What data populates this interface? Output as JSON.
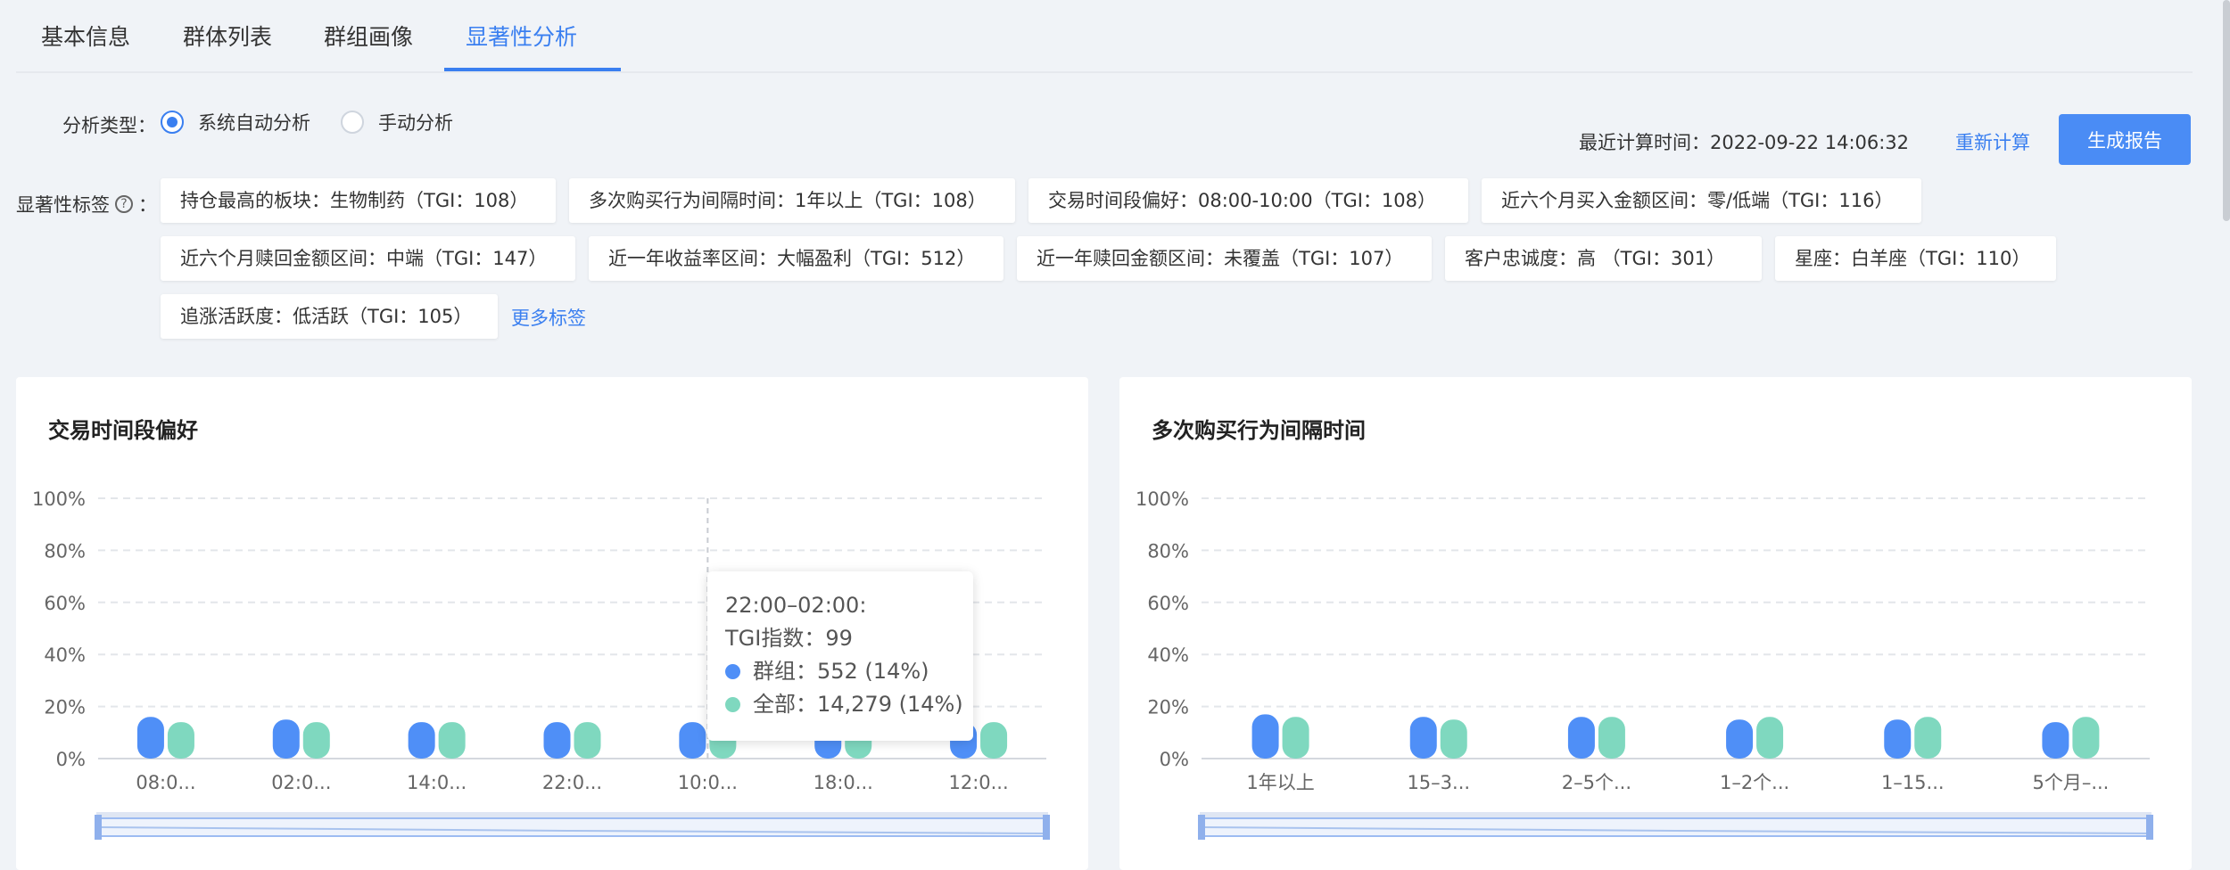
{
  "tabs": [
    {
      "label": "基本信息",
      "active": false
    },
    {
      "label": "群体列表",
      "active": false
    },
    {
      "label": "群组画像",
      "active": false
    },
    {
      "label": "显著性分析",
      "active": true
    }
  ],
  "analysis": {
    "label": "分析类型：",
    "options": [
      {
        "label": "系统自动分析",
        "selected": true
      },
      {
        "label": "手动分析",
        "selected": false
      }
    ],
    "last_calc": "最近计算时间：2022-09-22 14:06:32",
    "recalc_label": "重新计算",
    "generate_label": "生成报告"
  },
  "tags": {
    "label": "显著性标签",
    "colon": "：",
    "items": [
      "持仓最高的板块：生物制药（TGI：108）",
      "多次购买行为间隔时间：1年以上（TGI：108）",
      "交易时间段偏好：08:00-10:00（TGI：108）",
      "近六个月买入金额区间：零/低端（TGI：116）",
      "近六个月赎回金额区间：中端（TGI：147）",
      "近一年收益率区间：大幅盈利（TGI：512）",
      "近一年赎回金额区间：未覆盖（TGI：107）",
      "客户忠诚度：高 （TGI：301）",
      "星座：白羊座（TGI：110）",
      "追涨活跃度：低活跃（TGI：105）"
    ],
    "more_label": "更多标签"
  },
  "colors": {
    "group": "#4f8ff7",
    "all": "#7fd8bf",
    "accent": "#3a7ff0"
  },
  "icons": {
    "help": "question-circle-icon"
  },
  "charts": [
    {
      "title": "交易时间段偏好",
      "chart_data": {
        "type": "bar",
        "categories": [
          "08:0...",
          "02:0...",
          "14:0...",
          "22:0...",
          "10:0...",
          "18:0...",
          "12:0..."
        ],
        "series": [
          {
            "name": "群组",
            "values": [
              16,
              15,
              14,
              14,
              14,
              14,
              14
            ]
          },
          {
            "name": "全部",
            "values": [
              14,
              14,
              14,
              14,
              14,
              14,
              14
            ]
          }
        ],
        "y_ticks": [
          "0%",
          "20%",
          "40%",
          "60%",
          "80%",
          "100%"
        ],
        "ylim": [
          0,
          100
        ],
        "grid": true,
        "tooltip": {
          "title": "22:00–02:00:",
          "tgi": "TGI指数：99",
          "group": "群组：552 (14%)",
          "all": "全部：14,279 (14%)"
        }
      }
    },
    {
      "title": "多次购买行为间隔时间",
      "chart_data": {
        "type": "bar",
        "categories": [
          "1年以上",
          "15–3...",
          "2–5个...",
          "1–2个...",
          "1–15...",
          "5个月–..."
        ],
        "series": [
          {
            "name": "群组",
            "values": [
              17,
              16,
              16,
              15,
              15,
              14
            ]
          },
          {
            "name": "全部",
            "values": [
              16,
              15,
              16,
              16,
              16,
              16
            ]
          }
        ],
        "y_ticks": [
          "0%",
          "20%",
          "40%",
          "60%",
          "80%",
          "100%"
        ],
        "ylim": [
          0,
          100
        ],
        "grid": true
      }
    }
  ]
}
